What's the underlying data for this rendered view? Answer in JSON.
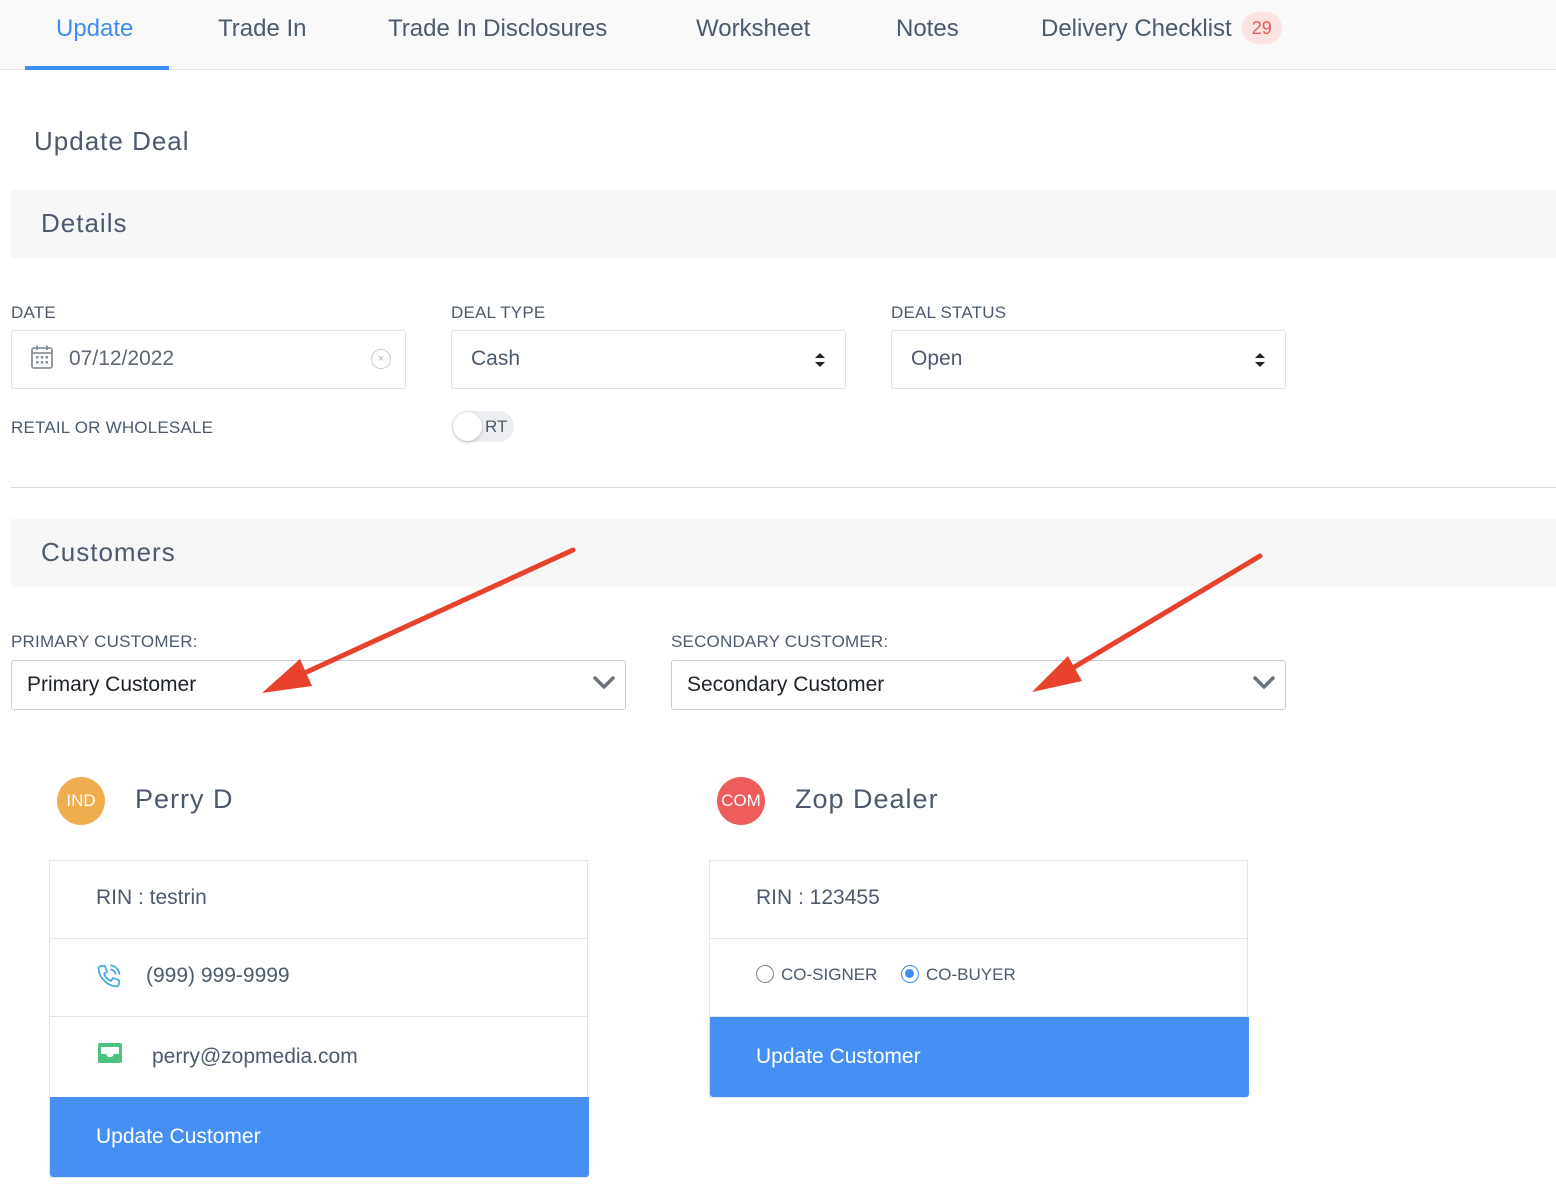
{
  "tabs": [
    {
      "label": "Update",
      "active": true
    },
    {
      "label": "Trade In"
    },
    {
      "label": "Trade In Disclosures"
    },
    {
      "label": "Worksheet"
    },
    {
      "label": "Notes"
    },
    {
      "label": "Delivery Checklist",
      "badge": "29"
    }
  ],
  "page_title": "Update Deal",
  "details": {
    "section_title": "Details",
    "date_label": "DATE",
    "date_value": "07/12/2022",
    "deal_type_label": "DEAL TYPE",
    "deal_type_value": "Cash",
    "deal_status_label": "DEAL STATUS",
    "deal_status_value": "Open",
    "retail_label": "RETAIL OR WHOLESALE",
    "retail_toggle_text": "RT"
  },
  "customers": {
    "section_title": "Customers",
    "primary_label": "PRIMARY CUSTOMER:",
    "primary_value": "Primary Customer",
    "secondary_label": "SECONDARY CUSTOMER:",
    "secondary_value": "Secondary Customer",
    "primary_card": {
      "avatar_text": "IND",
      "avatar_color": "#f0ad4e",
      "name": "Perry D",
      "rin": "RIN : testrin",
      "phone": "(999) 999-9999",
      "email": "perry@zopmedia.com",
      "button": "Update Customer"
    },
    "secondary_card": {
      "avatar_text": "COM",
      "avatar_color": "#ee5c5c",
      "name": "Zop Dealer",
      "rin": "RIN : 123455",
      "cosigner_label": "CO-SIGNER",
      "cobuyer_label": "CO-BUYER",
      "selected_role": "CO-BUYER",
      "button": "Update Customer"
    }
  },
  "colors": {
    "accent": "#3d8ef0",
    "button": "#4590f2",
    "annotation_arrow": "#e8412c",
    "badge_bg": "#fde2e2",
    "badge_text": "#e8595a"
  }
}
